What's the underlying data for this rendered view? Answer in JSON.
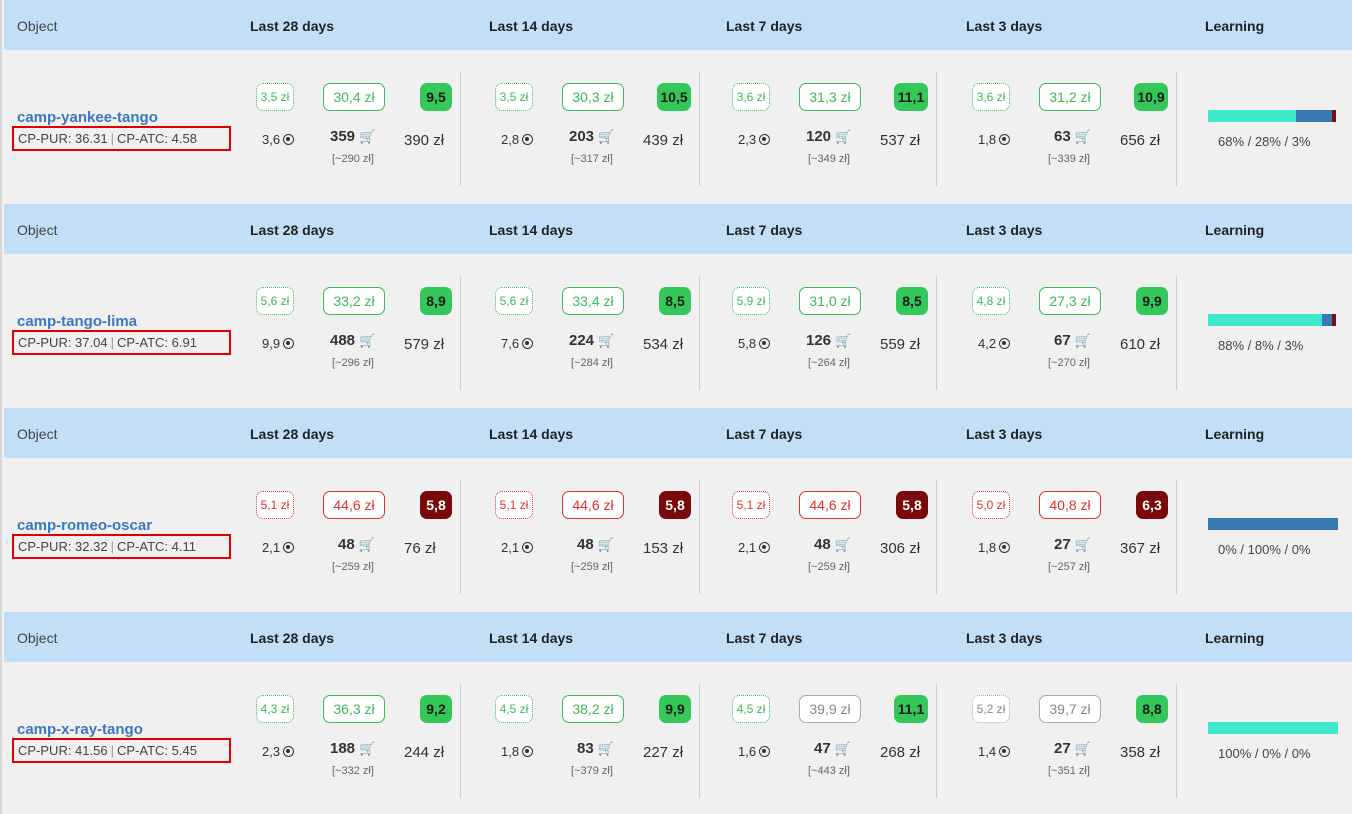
{
  "headers": {
    "object": "Object",
    "cols": [
      "Last 28 days",
      "Last 14 days",
      "Last 7 days",
      "Last 3 days"
    ],
    "learning": "Learning"
  },
  "icons": {
    "reach": "target-dot-icon",
    "cart": "shopping-cart-icon"
  },
  "colors": {
    "header_bg": "#c3dff7",
    "link": "#3a78c0",
    "good": "#34c759",
    "bad": "#7a0a0a",
    "highlight": "#e00000",
    "learn_a": "#3ee8c8",
    "learn_b": "#3a78b5",
    "learn_c": "#7a1010"
  },
  "campaigns": [
    {
      "name": "camp-yankee-tango",
      "cp_pur": "CP-PUR: 36.31",
      "cp_atc": "CP-ATC: 4.58",
      "periods": [
        {
          "small": "3,5 zł",
          "big": "30,4 zł",
          "score": "9,5",
          "status": "g",
          "score_type": "good",
          "reach": "3,6",
          "count": "359",
          "cpp": "[~290 zł]",
          "spend": "390 zł"
        },
        {
          "small": "3,5 zł",
          "big": "30,3 zł",
          "score": "10,5",
          "status": "g",
          "score_type": "good",
          "reach": "2,8",
          "count": "203",
          "cpp": "[~317 zł]",
          "spend": "439 zł"
        },
        {
          "small": "3,6 zł",
          "big": "31,3 zł",
          "score": "11,1",
          "status": "g",
          "score_type": "good",
          "reach": "2,3",
          "count": "120",
          "cpp": "[~349 zł]",
          "spend": "537 zł"
        },
        {
          "small": "3,6 zł",
          "big": "31,2 zł",
          "score": "10,9",
          "status": "g",
          "score_type": "good",
          "reach": "1,8",
          "count": "63",
          "cpp": "[~339 zł]",
          "spend": "656 zł"
        }
      ],
      "learning": {
        "a": 68,
        "b": 28,
        "c": 3,
        "text": "68% / 28% / 3%"
      }
    },
    {
      "name": "camp-tango-lima",
      "cp_pur": "CP-PUR: 37.04",
      "cp_atc": "CP-ATC: 6.91",
      "periods": [
        {
          "small": "5,6 zł",
          "big": "33,2 zł",
          "score": "8,9",
          "status": "g",
          "score_type": "good",
          "reach": "9,9",
          "count": "488",
          "cpp": "[~296 zł]",
          "spend": "579 zł"
        },
        {
          "small": "5,6 zł",
          "big": "33,4 zł",
          "score": "8,5",
          "status": "g",
          "score_type": "good",
          "reach": "7,6",
          "count": "224",
          "cpp": "[~284 zł]",
          "spend": "534 zł"
        },
        {
          "small": "5,9 zł",
          "big": "31,0 zł",
          "score": "8,5",
          "status": "g",
          "score_type": "good",
          "reach": "5,8",
          "count": "126",
          "cpp": "[~264 zł]",
          "spend": "559 zł"
        },
        {
          "small": "4,8 zł",
          "big": "27,3 zł",
          "score": "9,9",
          "status": "g",
          "score_type": "good",
          "reach": "4,2",
          "count": "67",
          "cpp": "[~270 zł]",
          "spend": "610 zł"
        }
      ],
      "learning": {
        "a": 88,
        "b": 8,
        "c": 3,
        "text": "88% / 8% / 3%"
      }
    },
    {
      "name": "camp-romeo-oscar",
      "cp_pur": "CP-PUR: 32.32",
      "cp_atc": "CP-ATC: 4.11",
      "periods": [
        {
          "small": "5,1 zł",
          "big": "44,6 zł",
          "score": "5,8",
          "status": "r",
          "score_type": "bad",
          "reach": "2,1",
          "count": "48",
          "cpp": "[~259 zł]",
          "spend": "76 zł"
        },
        {
          "small": "5,1 zł",
          "big": "44,6 zł",
          "score": "5,8",
          "status": "r",
          "score_type": "bad",
          "reach": "2,1",
          "count": "48",
          "cpp": "[~259 zł]",
          "spend": "153 zł"
        },
        {
          "small": "5,1 zł",
          "big": "44,6 zł",
          "score": "5,8",
          "status": "r",
          "score_type": "bad",
          "reach": "2,1",
          "count": "48",
          "cpp": "[~259 zł]",
          "spend": "306 zł"
        },
        {
          "small": "5,0 zł",
          "big": "40,8 zł",
          "score": "6,3",
          "status": "r",
          "score_type": "bad",
          "reach": "1,8",
          "count": "27",
          "cpp": "[~257 zł]",
          "spend": "367 zł"
        }
      ],
      "learning": {
        "a": 0,
        "b": 100,
        "c": 0,
        "text": "0% / 100% / 0%"
      }
    },
    {
      "name": "camp-x-ray-tango",
      "cp_pur": "CP-PUR: 41.56",
      "cp_atc": "CP-ATC: 5.45",
      "periods": [
        {
          "small": "4,3 zł",
          "big": "36,3 zł",
          "score": "9,2",
          "status": "g",
          "score_type": "good",
          "reach": "2,3",
          "count": "188",
          "cpp": "[~332 zł]",
          "spend": "244 zł"
        },
        {
          "small": "4,5 zł",
          "big": "38,2 zł",
          "score": "9,9",
          "status": "g",
          "score_type": "good",
          "reach": "1,8",
          "count": "83",
          "cpp": "[~379 zł]",
          "spend": "227 zł"
        },
        {
          "small": "4,5 zł",
          "big": "39,9 zł",
          "score": "11,1",
          "status": "gmix",
          "score_type": "good",
          "reach": "1,6",
          "count": "47",
          "cpp": "[~443 zł]",
          "spend": "268 zł"
        },
        {
          "small": "5,2 zł",
          "big": "39,7 zł",
          "score": "8,8",
          "status": "gr",
          "score_type": "good",
          "reach": "1,4",
          "count": "27",
          "cpp": "[~351 zł]",
          "spend": "358 zł"
        }
      ],
      "learning": {
        "a": 100,
        "b": 0,
        "c": 0,
        "text": "100% / 0% / 0%"
      }
    }
  ]
}
